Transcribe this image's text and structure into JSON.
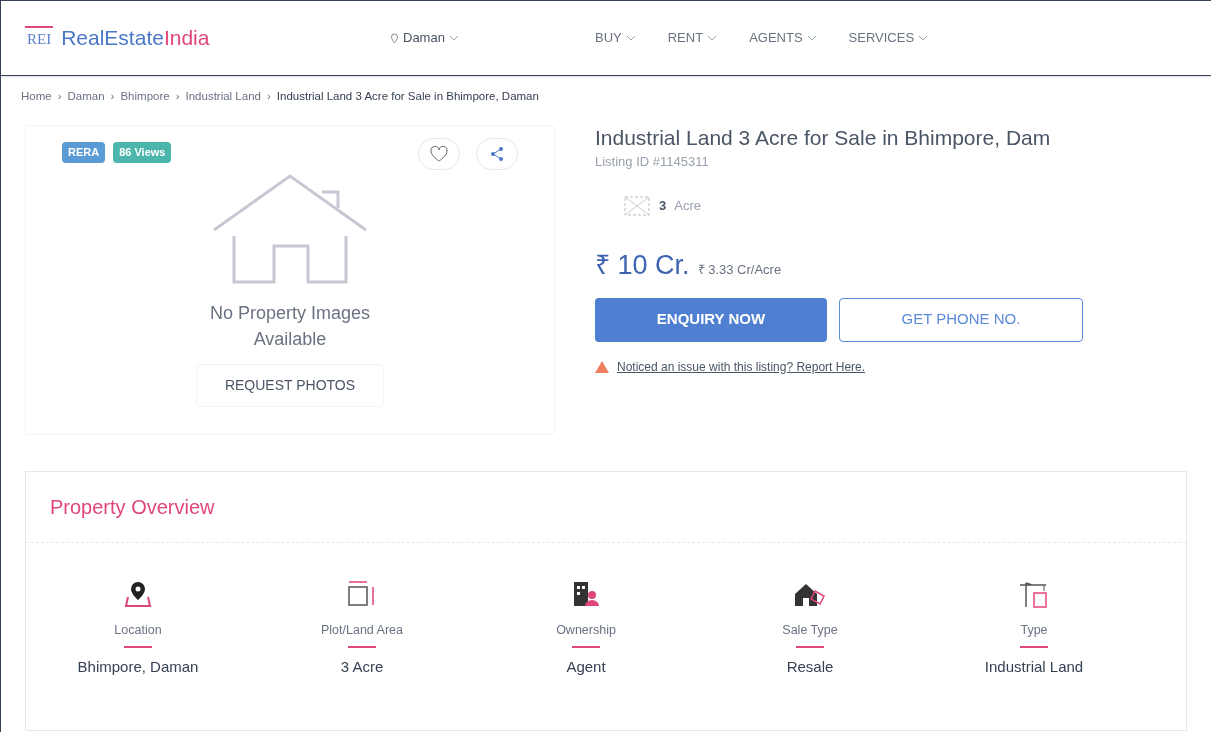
{
  "header": {
    "logo_mark": "REI",
    "logo_text_1": "RealEstate",
    "logo_text_2": "India",
    "location": "Daman",
    "nav": [
      "BUY",
      "RENT",
      "AGENTS",
      "SERVICES"
    ]
  },
  "breadcrumb": {
    "separator": "›",
    "items": [
      "Home",
      "Daman",
      "Bhimpore",
      "Industrial Land",
      "Industrial Land 3 Acre for Sale in Bhimpore, Daman"
    ]
  },
  "gallery": {
    "badges": [
      {
        "label": "RERA",
        "color": "#5b9bd5"
      },
      {
        "label": "86 Views",
        "color": "#4db6ac"
      }
    ],
    "message": "No Property Images Available",
    "button": "REQUEST PHOTOS"
  },
  "listing": {
    "title": "Industrial Land 3 Acre for Sale in Bhimpore, Dam",
    "listing_id": "Listing ID #1145311",
    "area_value": "3",
    "area_unit": "Acre",
    "price": "₹ 10 Cr.",
    "price_per_unit": "₹ 3.33 Cr/Acre",
    "primary_button": "ENQUIRY NOW",
    "secondary_button": "GET PHONE NO.",
    "report_link": "Noticed an issue with this listing? Report Here."
  },
  "overview": {
    "title": "Property Overview",
    "items": [
      {
        "kind": "location",
        "label": "Location",
        "value": "Bhimpore, Daman"
      },
      {
        "kind": "area",
        "label": "Plot/Land Area",
        "value": "3 Acre"
      },
      {
        "kind": "ownership",
        "label": "Ownership",
        "value": "Agent"
      },
      {
        "kind": "sale",
        "label": "Sale Type",
        "value": "Resale"
      },
      {
        "kind": "type",
        "label": "Type",
        "value": "Industrial Land"
      }
    ]
  }
}
